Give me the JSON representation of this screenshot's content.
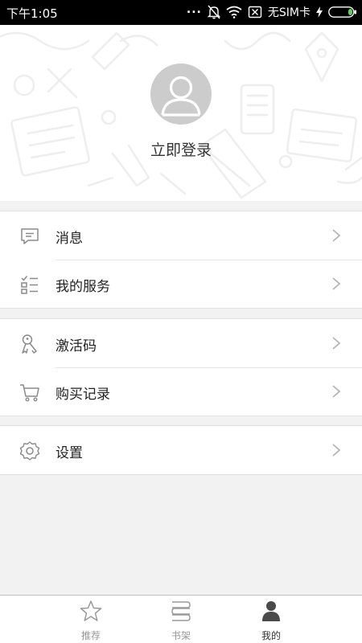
{
  "status_bar": {
    "time": "下午1:05",
    "carrier": "无SIM卡",
    "dots": "...",
    "icons": [
      "mute-bell-icon",
      "wifi-icon",
      "no-sim-icon",
      "charging-icon",
      "battery-icon"
    ]
  },
  "profile": {
    "login_label": "立即登录",
    "avatar_icon": "default-avatar-icon"
  },
  "menu": {
    "groups": [
      [
        {
          "label": "消息",
          "icon": "message-icon"
        },
        {
          "label": "我的服务",
          "icon": "service-list-icon"
        }
      ],
      [
        {
          "label": "激活码",
          "icon": "key-icon"
        },
        {
          "label": "购买记录",
          "icon": "cart-icon"
        }
      ],
      [
        {
          "label": "设置",
          "icon": "gear-icon"
        }
      ]
    ]
  },
  "tabbar": {
    "tabs": [
      {
        "label": "推荐",
        "icon": "star-icon",
        "active": false
      },
      {
        "label": "书架",
        "icon": "bookshelf-icon",
        "active": false
      },
      {
        "label": "我的",
        "icon": "person-icon",
        "active": true
      }
    ]
  },
  "colors": {
    "icon_gray": "#8a8a8a",
    "text": "#222222",
    "tab_inactive": "#999999",
    "tab_active": "#333333",
    "avatar_bg": "#cccccc"
  }
}
